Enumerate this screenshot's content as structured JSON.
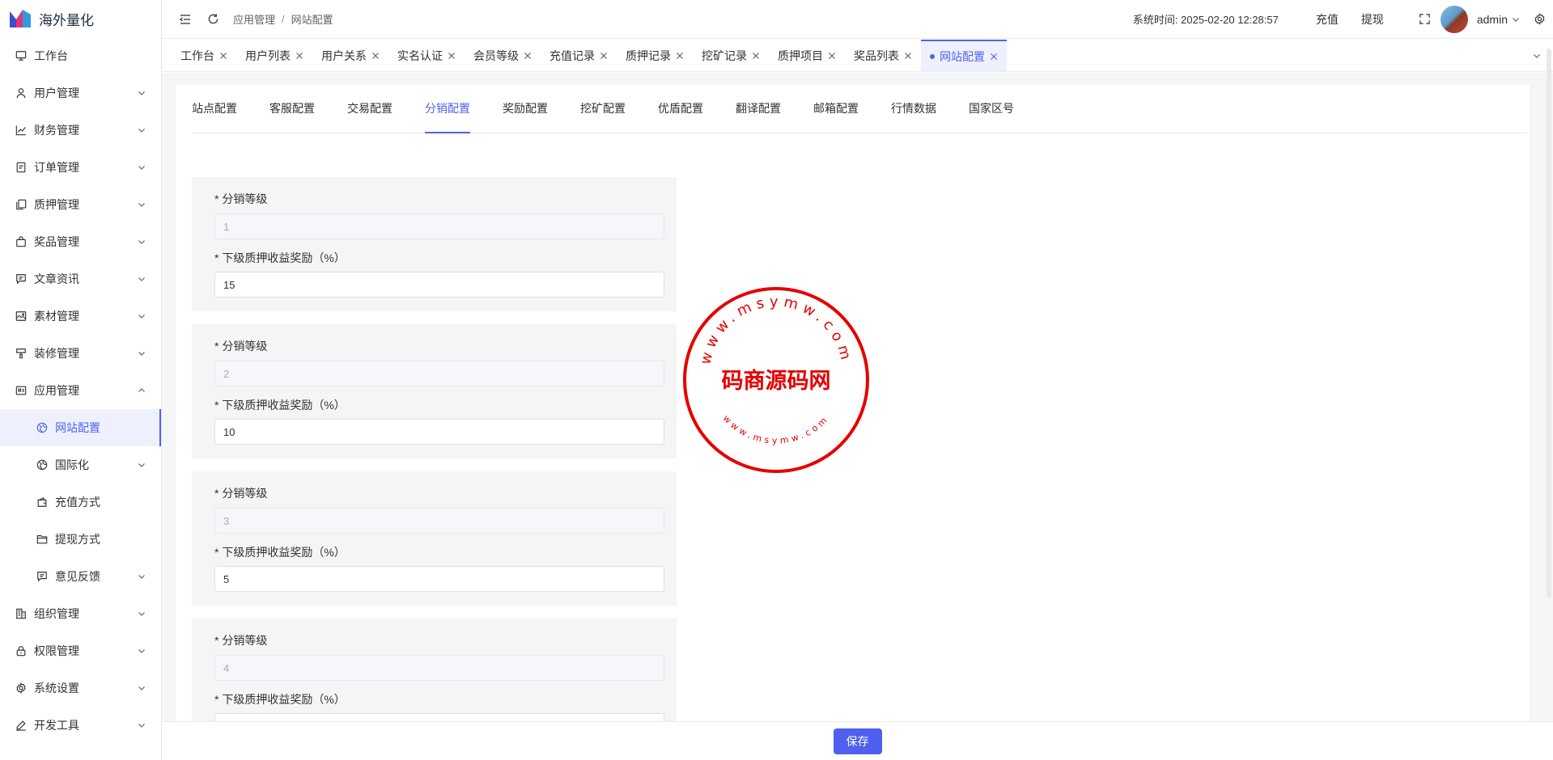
{
  "app": {
    "name": "海外量化"
  },
  "sidebar": {
    "items": [
      {
        "label": "工作台",
        "icon": "monitor-icon",
        "expandable": false
      },
      {
        "label": "用户管理",
        "icon": "user-icon",
        "expandable": true
      },
      {
        "label": "财务管理",
        "icon": "chart-icon",
        "expandable": true
      },
      {
        "label": "订单管理",
        "icon": "order-icon",
        "expandable": true
      },
      {
        "label": "质押管理",
        "icon": "copy-icon",
        "expandable": true
      },
      {
        "label": "奖品管理",
        "icon": "bag-icon",
        "expandable": true
      },
      {
        "label": "文章资讯",
        "icon": "message-icon",
        "expandable": true
      },
      {
        "label": "素材管理",
        "icon": "picture-icon",
        "expandable": true
      },
      {
        "label": "装修管理",
        "icon": "brush-icon",
        "expandable": true
      },
      {
        "label": "应用管理",
        "icon": "app-icon",
        "expandable": true,
        "expanded": true
      },
      {
        "label": "网站配置",
        "icon": "globe-icon",
        "sub": true,
        "active": true
      },
      {
        "label": "国际化",
        "icon": "globe-icon",
        "sub": true,
        "expandable": true
      },
      {
        "label": "充值方式",
        "icon": "wallet-icon",
        "sub": true
      },
      {
        "label": "提现方式",
        "icon": "folder-icon",
        "sub": true
      },
      {
        "label": "意见反馈",
        "icon": "message-icon",
        "sub": true,
        "expandable": true
      },
      {
        "label": "组织管理",
        "icon": "building-icon",
        "expandable": true
      },
      {
        "label": "权限管理",
        "icon": "lock-icon",
        "expandable": true
      },
      {
        "label": "系统设置",
        "icon": "gear-icon",
        "expandable": true
      },
      {
        "label": "开发工具",
        "icon": "pen-icon",
        "expandable": true
      }
    ]
  },
  "header": {
    "breadcrumb": [
      "应用管理",
      "网站配置"
    ],
    "system_time_label": "系统时间:",
    "system_time": "2025-02-20 12:28:57",
    "recharge": "充值",
    "withdraw": "提现",
    "username": "admin"
  },
  "tabs": [
    {
      "label": "工作台"
    },
    {
      "label": "用户列表"
    },
    {
      "label": "用户关系"
    },
    {
      "label": "实名认证"
    },
    {
      "label": "会员等级"
    },
    {
      "label": "充值记录"
    },
    {
      "label": "质押记录"
    },
    {
      "label": "挖矿记录"
    },
    {
      "label": "质押项目"
    },
    {
      "label": "奖品列表"
    },
    {
      "label": "网站配置",
      "active": true
    }
  ],
  "config_tabs": [
    {
      "label": "站点配置"
    },
    {
      "label": "客服配置"
    },
    {
      "label": "交易配置"
    },
    {
      "label": "分销配置",
      "active": true
    },
    {
      "label": "奖励配置"
    },
    {
      "label": "挖矿配置"
    },
    {
      "label": "优盾配置"
    },
    {
      "label": "翻译配置"
    },
    {
      "label": "邮箱配置"
    },
    {
      "label": "行情数据"
    },
    {
      "label": "国家区号"
    }
  ],
  "distribution": {
    "level_label": "* 分销等级",
    "reward_label": "* 下级质押收益奖励（%）",
    "levels": [
      {
        "level": "1",
        "reward": "15"
      },
      {
        "level": "2",
        "reward": "10"
      },
      {
        "level": "3",
        "reward": "5"
      },
      {
        "level": "4",
        "reward": ""
      }
    ]
  },
  "stamp": {
    "top_text": "www.msymw.com",
    "center_text": "码商源码网",
    "bottom_text": "www.msymw.com",
    "color": "#e60000"
  },
  "footer": {
    "save_label": "保存"
  },
  "colors": {
    "accent": "#4f63f0",
    "active_bg": "#eef0fe"
  }
}
